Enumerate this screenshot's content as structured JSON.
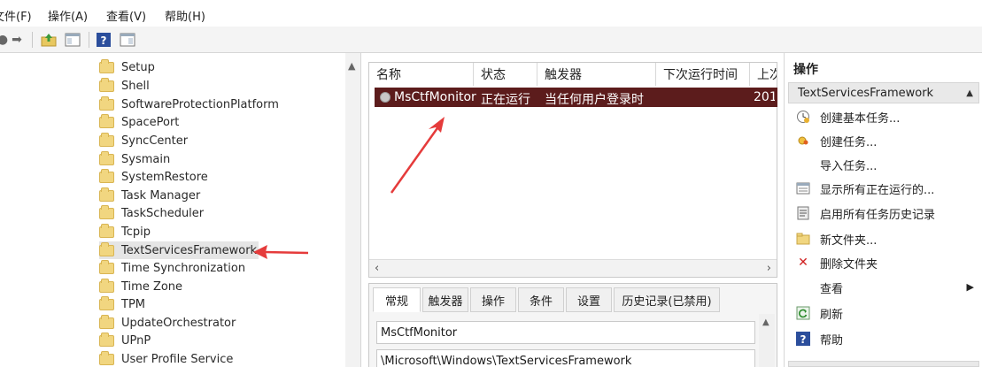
{
  "menu": {
    "file": "文件(F)",
    "action": "操作(A)",
    "view": "查看(V)",
    "help": "帮助(H)"
  },
  "toolbar": {
    "icons": [
      "back-arrow-icon",
      "forward-arrow-icon",
      "up-folder-icon",
      "show-hide-tree-icon",
      "help-icon",
      "show-pane-icon"
    ]
  },
  "tree": {
    "items": [
      {
        "label": "Setup"
      },
      {
        "label": "Shell"
      },
      {
        "label": "SoftwareProtectionPlatform"
      },
      {
        "label": "SpacePort"
      },
      {
        "label": "SyncCenter"
      },
      {
        "label": "Sysmain"
      },
      {
        "label": "SystemRestore"
      },
      {
        "label": "Task Manager"
      },
      {
        "label": "TaskScheduler"
      },
      {
        "label": "Tcpip"
      },
      {
        "label": "TextServicesFramework"
      },
      {
        "label": "Time Synchronization"
      },
      {
        "label": "Time Zone"
      },
      {
        "label": "TPM"
      },
      {
        "label": "UpdateOrchestrator"
      },
      {
        "label": "UPnP"
      },
      {
        "label": "User Profile Service"
      }
    ],
    "selected_index": 10
  },
  "tasklist": {
    "columns": [
      "名称",
      "状态",
      "触发器",
      "下次运行时间",
      "上次"
    ],
    "rows": [
      {
        "name": "MsCtfMonitor",
        "status": "正在运行",
        "trigger": "当任何用户登录时",
        "last": "201"
      }
    ],
    "selected_color": "#5c1c1c"
  },
  "details": {
    "tabs": [
      "常规",
      "触发器",
      "操作",
      "条件",
      "设置",
      "历史记录(已禁用)"
    ],
    "active_tab": "常规",
    "name_value": "MsCtfMonitor",
    "path_value": "\\Microsoft\\Windows\\TextServicesFramework"
  },
  "actions": {
    "header": "操作",
    "section": "TextServicesFramework",
    "items": [
      {
        "label": "创建基本任务...",
        "icon": "create-basic-task-icon"
      },
      {
        "label": "创建任务...",
        "icon": "create-task-icon"
      },
      {
        "label": "导入任务...",
        "icon": ""
      },
      {
        "label": "显示所有正在运行的...",
        "icon": "running-tasks-icon"
      },
      {
        "label": "启用所有任务历史记录",
        "icon": "history-icon"
      },
      {
        "label": "新文件夹...",
        "icon": "new-folder-icon"
      },
      {
        "label": "删除文件夹",
        "icon": "delete-icon"
      },
      {
        "label": "查看",
        "icon": ""
      },
      {
        "label": "刷新",
        "icon": "refresh-icon"
      },
      {
        "label": "帮助",
        "icon": "help-icon"
      }
    ]
  },
  "colors": {
    "selection_bg": "#5c1c1c",
    "annotation": "#e53b3b"
  }
}
